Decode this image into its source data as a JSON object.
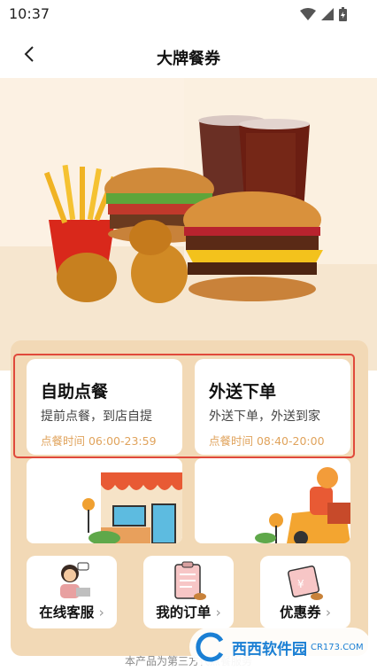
{
  "status_bar": {
    "time": "10:37"
  },
  "header": {
    "title": "大牌餐券"
  },
  "cards": {
    "self_order": {
      "title": "自助点餐",
      "desc": "提前点餐，到店自提",
      "time": "点餐时间 06:00-23:59"
    },
    "delivery": {
      "title": "外送下单",
      "desc": "外送下单，外送到家",
      "time": "点餐时间 08:40-20:00"
    }
  },
  "shortcuts": [
    {
      "label": "在线客服"
    },
    {
      "label": "我的订单"
    },
    {
      "label": "优惠券"
    }
  ],
  "footer": {
    "note": "本产品为第三方代点餐服务"
  },
  "watermark": {
    "text": "西西软件园",
    "sub": "CR173.COM"
  },
  "colors": {
    "accent": "#e0a35c",
    "highlight": "#e0493b",
    "panel": "#f2d9b6"
  }
}
